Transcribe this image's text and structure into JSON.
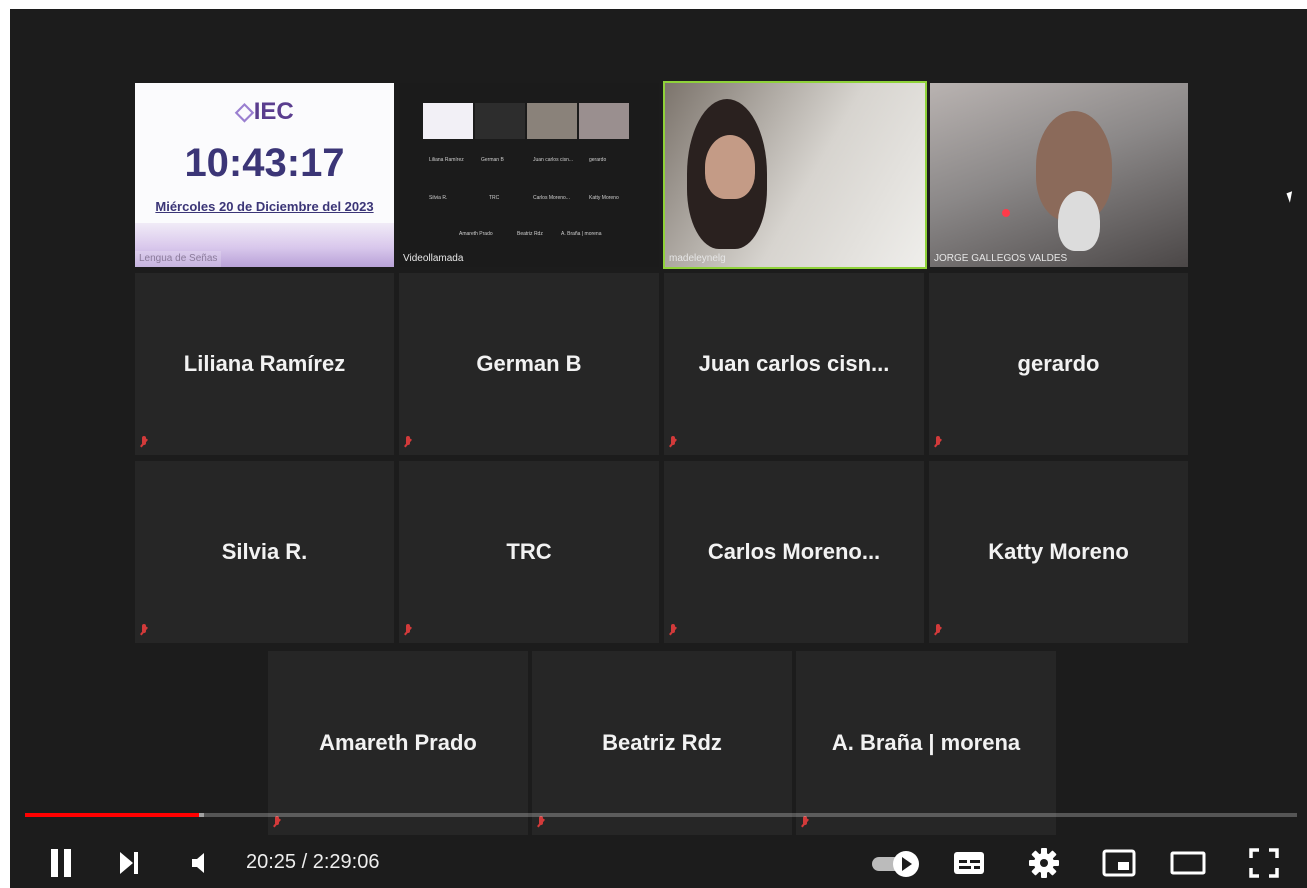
{
  "screen_share": {
    "logo_text": "IEC",
    "clock": "10:43:17",
    "date": "Miércoles 20 de Diciembre del 2023",
    "caption": "Lengua de Señas"
  },
  "video_call_tile": {
    "caption": "Videollamada",
    "mini_grid_labels": [
      "Liliana Ramírez",
      "German B",
      "Juan carlos cisn...",
      "gerardo",
      "Silvia R.",
      "TRC",
      "Carlos Moreno...",
      "Katty Moreno",
      "Amareth Prado",
      "Beatriz Rdz",
      "A. Braña | morena"
    ]
  },
  "camera_tiles": [
    {
      "caption": "madeleynelg",
      "active_speaker": true
    },
    {
      "caption": "JORGE GALLEGOS VALDES",
      "active_speaker": false
    }
  ],
  "participants": [
    {
      "name": "Liliana Ramírez"
    },
    {
      "name": "German B"
    },
    {
      "name": "Juan  carlos  cisn..."
    },
    {
      "name": "gerardo"
    },
    {
      "name": "Silvia R."
    },
    {
      "name": "TRC"
    },
    {
      "name": "Carlos  Moreno..."
    },
    {
      "name": "Katty Moreno"
    },
    {
      "name": "Amareth Prado"
    },
    {
      "name": "Beatriz Rdz"
    },
    {
      "name": "A. Braña | morena"
    }
  ],
  "player": {
    "current_time": "20:25",
    "separator": "/",
    "duration": "2:29:06",
    "time_display": "20:25 / 2:29:06",
    "played_fraction": 0.137,
    "buffered_fraction": 0.141,
    "progress_color": "#ff0000"
  }
}
